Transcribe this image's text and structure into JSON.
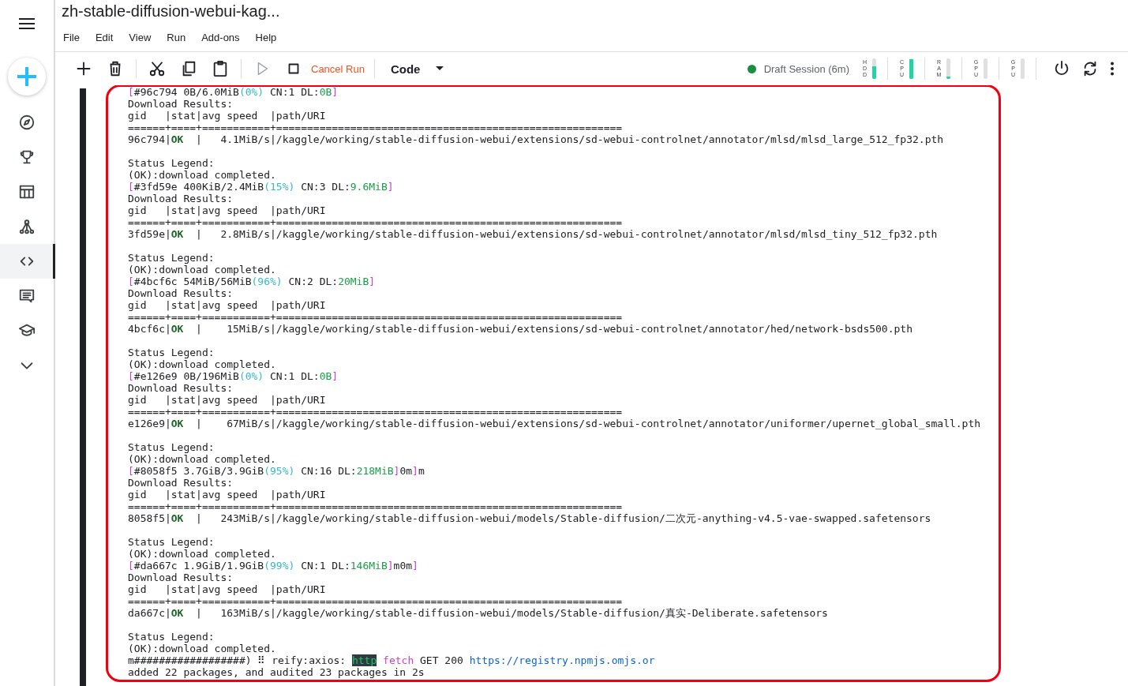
{
  "sidebar": {
    "items": [
      {
        "kind": "compass",
        "selected": false
      },
      {
        "kind": "trophy",
        "selected": false
      },
      {
        "kind": "table",
        "selected": false
      },
      {
        "kind": "nodes",
        "selected": false
      },
      {
        "kind": "code",
        "selected": true
      },
      {
        "kind": "comment",
        "selected": false
      },
      {
        "kind": "cap",
        "selected": false
      },
      {
        "kind": "chevron",
        "selected": false
      }
    ]
  },
  "title": "zh-stable-diffusion-webui-kag...",
  "menu": [
    "File",
    "Edit",
    "View",
    "Run",
    "Add-ons",
    "Help"
  ],
  "toolbar": {
    "groups": [
      [
        {
          "kind": "add",
          "disabled": false
        },
        {
          "kind": "delete",
          "disabled": false
        }
      ],
      [
        {
          "kind": "cut",
          "disabled": false
        },
        {
          "kind": "copy",
          "disabled": false
        },
        {
          "kind": "paste",
          "disabled": false
        }
      ],
      [
        {
          "kind": "run",
          "disabled": true
        },
        {
          "kind": "stop",
          "disabled": false
        },
        {
          "kind": "label",
          "label": "Cancel Run",
          "disabled": false
        }
      ],
      [
        {
          "kind": "dropdown",
          "label": "Code",
          "disabled": false
        }
      ]
    ]
  },
  "session": {
    "label": "Draft Session (6m)",
    "active": true,
    "meters": [
      {
        "label": "HDD",
        "level": 0.6
      },
      {
        "label": "CPU",
        "level": 0.95
      },
      {
        "label": "RAM",
        "level": 0.1
      },
      {
        "label": "GPU",
        "level": 0
      },
      {
        "label": "GPU",
        "level": 0
      }
    ]
  },
  "annotation": {
    "kind": "outline"
  },
  "output": {
    "blocks": [
      {
        "lines": [
          [
            {
              "text": "[",
              "kind": "magenta"
            },
            {
              "text": "#96c794 0B/6.0MiB",
              "kind": "plain"
            },
            {
              "text": "(0%)",
              "kind": "cyan"
            },
            {
              "text": " CN:1 DL:",
              "kind": "plain"
            },
            {
              "text": "0B",
              "kind": "green"
            },
            {
              "text": "]",
              "kind": "magenta"
            }
          ],
          [
            {
              "text": "Download Results:",
              "kind": "plain"
            }
          ],
          [
            {
              "text": "gid   |stat|avg speed  |path/URI",
              "kind": "plain"
            }
          ],
          [
            {
              "text": "======+====+===========+========================================================",
              "kind": "plain"
            }
          ],
          [
            {
              "text": "96c794|",
              "kind": "plain"
            },
            {
              "text": "OK",
              "kind": "ok"
            },
            {
              "text": "  |   4.1MiB/s|/kaggle/working/stable-diffusion-webui/extensions/sd-webui-controlnet/annotator/mlsd/mlsd_large_512_fp32.pth",
              "kind": "plain"
            }
          ]
        ]
      },
      {
        "lines": [
          [
            {
              "text": "Status Legend:",
              "kind": "plain"
            }
          ],
          [
            {
              "text": "(OK):download completed.",
              "kind": "plain"
            }
          ],
          [
            {
              "text": "[",
              "kind": "magenta"
            },
            {
              "text": "#3fd59e 400KiB/2.4MiB",
              "kind": "plain"
            },
            {
              "text": "(15%)",
              "kind": "cyan"
            },
            {
              "text": " CN:3 DL:",
              "kind": "plain"
            },
            {
              "text": "9.6MiB",
              "kind": "green"
            },
            {
              "text": "]",
              "kind": "magenta"
            }
          ],
          [
            {
              "text": "Download Results:",
              "kind": "plain"
            }
          ],
          [
            {
              "text": "gid   |stat|avg speed  |path/URI",
              "kind": "plain"
            }
          ],
          [
            {
              "text": "======+====+===========+========================================================",
              "kind": "plain"
            }
          ],
          [
            {
              "text": "3fd59e|",
              "kind": "plain"
            },
            {
              "text": "OK",
              "kind": "ok"
            },
            {
              "text": "  |   2.8MiB/s|/kaggle/working/stable-diffusion-webui/extensions/sd-webui-controlnet/annotator/mlsd/mlsd_tiny_512_fp32.pth",
              "kind": "plain"
            }
          ]
        ]
      },
      {
        "lines": [
          [
            {
              "text": "Status Legend:",
              "kind": "plain"
            }
          ],
          [
            {
              "text": "(OK):download completed.",
              "kind": "plain"
            }
          ],
          [
            {
              "text": "[",
              "kind": "magenta"
            },
            {
              "text": "#4bcf6c 54MiB/56MiB",
              "kind": "plain"
            },
            {
              "text": "(96%)",
              "kind": "cyan"
            },
            {
              "text": " CN:2 DL:",
              "kind": "plain"
            },
            {
              "text": "20MiB",
              "kind": "green"
            },
            {
              "text": "]",
              "kind": "magenta"
            }
          ],
          [
            {
              "text": "Download Results:",
              "kind": "plain"
            }
          ],
          [
            {
              "text": "gid   |stat|avg speed  |path/URI",
              "kind": "plain"
            }
          ],
          [
            {
              "text": "======+====+===========+========================================================",
              "kind": "plain"
            }
          ],
          [
            {
              "text": "4bcf6c|",
              "kind": "plain"
            },
            {
              "text": "OK",
              "kind": "ok"
            },
            {
              "text": "  |    15MiB/s|/kaggle/working/stable-diffusion-webui/extensions/sd-webui-controlnet/annotator/hed/network-bsds500.pth",
              "kind": "plain"
            }
          ]
        ]
      },
      {
        "lines": [
          [
            {
              "text": "Status Legend:",
              "kind": "plain"
            }
          ],
          [
            {
              "text": "(OK):download completed.",
              "kind": "plain"
            }
          ],
          [
            {
              "text": "[",
              "kind": "magenta"
            },
            {
              "text": "#e126e9 0B/196MiB",
              "kind": "plain"
            },
            {
              "text": "(0%)",
              "kind": "cyan"
            },
            {
              "text": " CN:1 DL:",
              "kind": "plain"
            },
            {
              "text": "0B",
              "kind": "green"
            },
            {
              "text": "]",
              "kind": "magenta"
            }
          ],
          [
            {
              "text": "Download Results:",
              "kind": "plain"
            }
          ],
          [
            {
              "text": "gid   |stat|avg speed  |path/URI",
              "kind": "plain"
            }
          ],
          [
            {
              "text": "======+====+===========+========================================================",
              "kind": "plain"
            }
          ],
          [
            {
              "text": "e126e9|",
              "kind": "plain"
            },
            {
              "text": "OK",
              "kind": "ok"
            },
            {
              "text": "  |    67MiB/s|/kaggle/working/stable-diffusion-webui/extensions/sd-webui-controlnet/annotator/uniformer/upernet_global_small.pth",
              "kind": "plain"
            }
          ]
        ]
      },
      {
        "lines": [
          [
            {
              "text": "Status Legend:",
              "kind": "plain"
            }
          ],
          [
            {
              "text": "(OK):download completed.",
              "kind": "plain"
            }
          ],
          [
            {
              "text": "[",
              "kind": "magenta"
            },
            {
              "text": "#8058f5 3.7GiB/3.9GiB",
              "kind": "plain"
            },
            {
              "text": "(95%)",
              "kind": "cyan"
            },
            {
              "text": " CN:16 DL:",
              "kind": "plain"
            },
            {
              "text": "218MiB",
              "kind": "green"
            },
            {
              "text": "]",
              "kind": "magenta"
            },
            {
              "text": "0m",
              "kind": "plain"
            },
            {
              "text": "]",
              "kind": "magenta"
            },
            {
              "text": "m",
              "kind": "plain"
            }
          ],
          [
            {
              "text": "Download Results:",
              "kind": "plain"
            }
          ],
          [
            {
              "text": "gid   |stat|avg speed  |path/URI",
              "kind": "plain"
            }
          ],
          [
            {
              "text": "======+====+===========+========================================================",
              "kind": "plain"
            }
          ],
          [
            {
              "text": "8058f5|",
              "kind": "plain"
            },
            {
              "text": "OK",
              "kind": "ok"
            },
            {
              "text": "  |   243MiB/s|/kaggle/working/stable-diffusion-webui/models/Stable-diffusion/二次元-anything-v4.5-vae-swapped.safetensors",
              "kind": "plain"
            }
          ]
        ]
      },
      {
        "lines": [
          [
            {
              "text": "Status Legend:",
              "kind": "plain"
            }
          ],
          [
            {
              "text": "(OK):download completed.",
              "kind": "plain"
            }
          ],
          [
            {
              "text": "[",
              "kind": "magenta"
            },
            {
              "text": "#da667c 1.9GiB/1.9GiB",
              "kind": "plain"
            },
            {
              "text": "(99%)",
              "kind": "cyan"
            },
            {
              "text": " CN:1 DL:",
              "kind": "plain"
            },
            {
              "text": "146MiB",
              "kind": "green"
            },
            {
              "text": "]",
              "kind": "magenta"
            },
            {
              "text": "m0m",
              "kind": "plain"
            },
            {
              "text": "]",
              "kind": "magenta"
            }
          ],
          [
            {
              "text": "Download Results:",
              "kind": "plain"
            }
          ],
          [
            {
              "text": "gid   |stat|avg speed  |path/URI",
              "kind": "plain"
            }
          ],
          [
            {
              "text": "======+====+===========+========================================================",
              "kind": "plain"
            }
          ],
          [
            {
              "text": "da667c|",
              "kind": "plain"
            },
            {
              "text": "OK",
              "kind": "ok"
            },
            {
              "text": "  |   163MiB/s|/kaggle/working/stable-diffusion-webui/models/Stable-diffusion/真实-Deliberate.safetensors",
              "kind": "plain"
            }
          ]
        ]
      },
      {
        "lines": [
          [
            {
              "text": "Status Legend:",
              "kind": "plain"
            }
          ],
          [
            {
              "text": "(OK):download completed.",
              "kind": "plain"
            }
          ],
          [
            {
              "text": "m##################) ⠿ reify:axios: ",
              "kind": "plain"
            },
            {
              "text": "http",
              "kind": "badge"
            },
            {
              "text": " fetch",
              "kind": "magenta"
            },
            {
              "text": " GET 200 ",
              "kind": "plain"
            },
            {
              "text": "https://registry.npmjs.omjs.or",
              "kind": "link"
            }
          ],
          [
            {
              "text": "added 22 packages, and audited 23 packages in 2s",
              "kind": "plain"
            }
          ]
        ]
      }
    ]
  }
}
